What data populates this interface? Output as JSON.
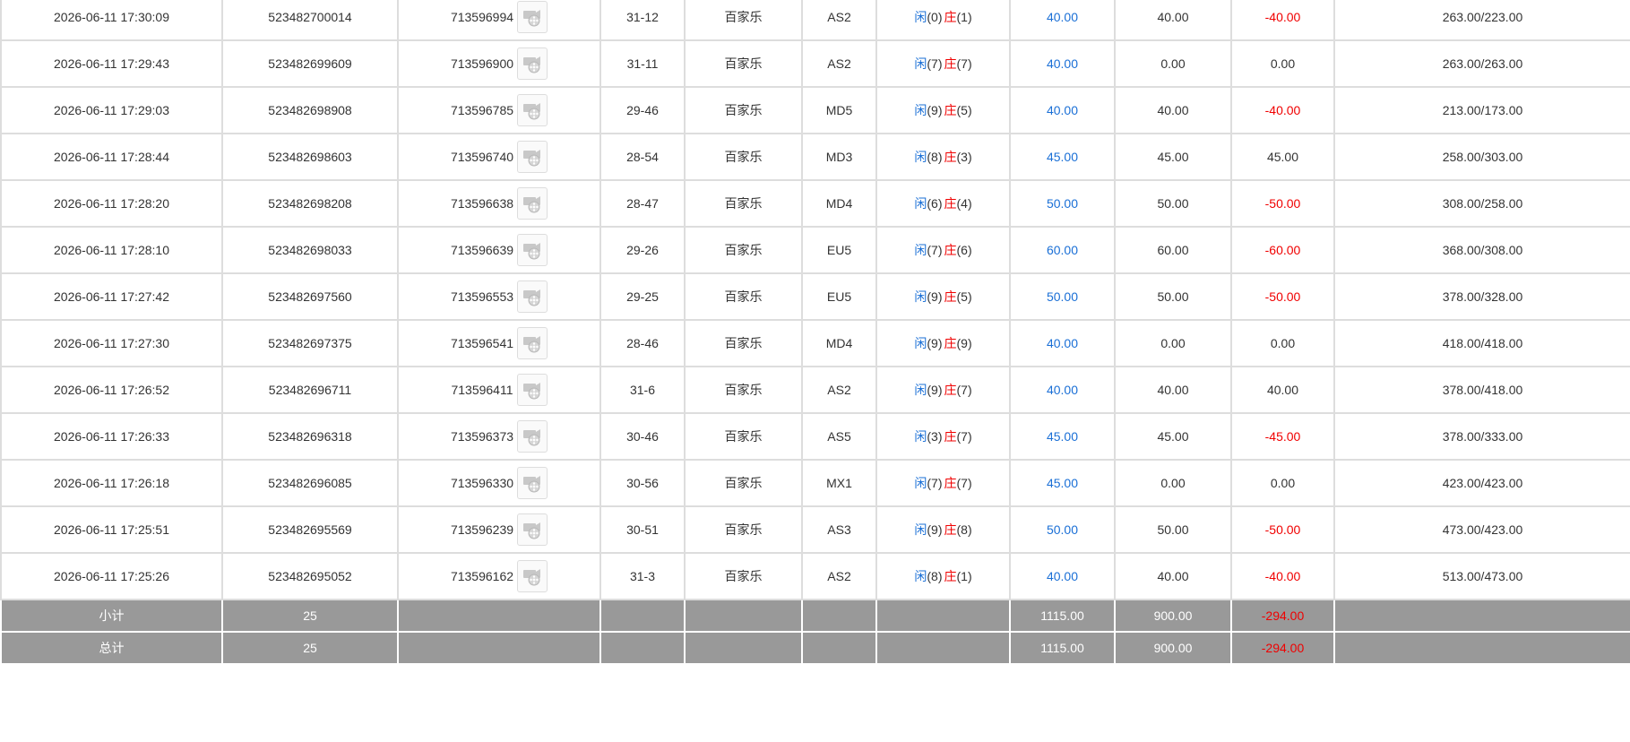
{
  "rows": [
    {
      "time": "2026-06-11 17:30:09",
      "order_id": "523482700014",
      "game_id": "713596994",
      "round": "31-12",
      "game": "百家乐",
      "table": "AS2",
      "p_label": "闲",
      "p_val": "(0)",
      "b_label": "庄",
      "b_val": "(1)",
      "bet": "40.00",
      "valid": "40.00",
      "win": "-40.00",
      "win_neg": true,
      "balance": "263.00/223.00"
    },
    {
      "time": "2026-06-11 17:29:43",
      "order_id": "523482699609",
      "game_id": "713596900",
      "round": "31-11",
      "game": "百家乐",
      "table": "AS2",
      "p_label": "闲",
      "p_val": "(7)",
      "b_label": "庄",
      "b_val": "(7)",
      "bet": "40.00",
      "valid": "0.00",
      "win": "0.00",
      "win_neg": false,
      "balance": "263.00/263.00"
    },
    {
      "time": "2026-06-11 17:29:03",
      "order_id": "523482698908",
      "game_id": "713596785",
      "round": "29-46",
      "game": "百家乐",
      "table": "MD5",
      "p_label": "闲",
      "p_val": "(9)",
      "b_label": "庄",
      "b_val": "(5)",
      "bet": "40.00",
      "valid": "40.00",
      "win": "-40.00",
      "win_neg": true,
      "balance": "213.00/173.00"
    },
    {
      "time": "2026-06-11 17:28:44",
      "order_id": "523482698603",
      "game_id": "713596740",
      "round": "28-54",
      "game": "百家乐",
      "table": "MD3",
      "p_label": "闲",
      "p_val": "(8)",
      "b_label": "庄",
      "b_val": "(3)",
      "bet": "45.00",
      "valid": "45.00",
      "win": "45.00",
      "win_neg": false,
      "balance": "258.00/303.00"
    },
    {
      "time": "2026-06-11 17:28:20",
      "order_id": "523482698208",
      "game_id": "713596638",
      "round": "28-47",
      "game": "百家乐",
      "table": "MD4",
      "p_label": "闲",
      "p_val": "(6)",
      "b_label": "庄",
      "b_val": "(4)",
      "bet": "50.00",
      "valid": "50.00",
      "win": "-50.00",
      "win_neg": true,
      "balance": "308.00/258.00"
    },
    {
      "time": "2026-06-11 17:28:10",
      "order_id": "523482698033",
      "game_id": "713596639",
      "round": "29-26",
      "game": "百家乐",
      "table": "EU5",
      "p_label": "闲",
      "p_val": "(7)",
      "b_label": "庄",
      "b_val": "(6)",
      "bet": "60.00",
      "valid": "60.00",
      "win": "-60.00",
      "win_neg": true,
      "balance": "368.00/308.00"
    },
    {
      "time": "2026-06-11 17:27:42",
      "order_id": "523482697560",
      "game_id": "713596553",
      "round": "29-25",
      "game": "百家乐",
      "table": "EU5",
      "p_label": "闲",
      "p_val": "(9)",
      "b_label": "庄",
      "b_val": "(5)",
      "bet": "50.00",
      "valid": "50.00",
      "win": "-50.00",
      "win_neg": true,
      "balance": "378.00/328.00"
    },
    {
      "time": "2026-06-11 17:27:30",
      "order_id": "523482697375",
      "game_id": "713596541",
      "round": "28-46",
      "game": "百家乐",
      "table": "MD4",
      "p_label": "闲",
      "p_val": "(9)",
      "b_label": "庄",
      "b_val": "(9)",
      "bet": "40.00",
      "valid": "0.00",
      "win": "0.00",
      "win_neg": false,
      "balance": "418.00/418.00"
    },
    {
      "time": "2026-06-11 17:26:52",
      "order_id": "523482696711",
      "game_id": "713596411",
      "round": "31-6",
      "game": "百家乐",
      "table": "AS2",
      "p_label": "闲",
      "p_val": "(9)",
      "b_label": "庄",
      "b_val": "(7)",
      "bet": "40.00",
      "valid": "40.00",
      "win": "40.00",
      "win_neg": false,
      "balance": "378.00/418.00"
    },
    {
      "time": "2026-06-11 17:26:33",
      "order_id": "523482696318",
      "game_id": "713596373",
      "round": "30-46",
      "game": "百家乐",
      "table": "AS5",
      "p_label": "闲",
      "p_val": "(3)",
      "b_label": "庄",
      "b_val": "(7)",
      "bet": "45.00",
      "valid": "45.00",
      "win": "-45.00",
      "win_neg": true,
      "balance": "378.00/333.00"
    },
    {
      "time": "2026-06-11 17:26:18",
      "order_id": "523482696085",
      "game_id": "713596330",
      "round": "30-56",
      "game": "百家乐",
      "table": "MX1",
      "p_label": "闲",
      "p_val": "(7)",
      "b_label": "庄",
      "b_val": "(7)",
      "bet": "45.00",
      "valid": "0.00",
      "win": "0.00",
      "win_neg": false,
      "balance": "423.00/423.00"
    },
    {
      "time": "2026-06-11 17:25:51",
      "order_id": "523482695569",
      "game_id": "713596239",
      "round": "30-51",
      "game": "百家乐",
      "table": "AS3",
      "p_label": "闲",
      "p_val": "(9)",
      "b_label": "庄",
      "b_val": "(8)",
      "bet": "50.00",
      "valid": "50.00",
      "win": "-50.00",
      "win_neg": true,
      "balance": "473.00/423.00"
    },
    {
      "time": "2026-06-11 17:25:26",
      "order_id": "523482695052",
      "game_id": "713596162",
      "round": "31-3",
      "game": "百家乐",
      "table": "AS2",
      "p_label": "闲",
      "p_val": "(8)",
      "b_label": "庄",
      "b_val": "(1)",
      "bet": "40.00",
      "valid": "40.00",
      "win": "-40.00",
      "win_neg": true,
      "balance": "513.00/473.00"
    }
  ],
  "subtotal": {
    "label": "小计",
    "count": "25",
    "bet": "1115.00",
    "valid": "900.00",
    "win": "-294.00"
  },
  "total": {
    "label": "总计",
    "count": "25",
    "bet": "1115.00",
    "valid": "900.00",
    "win": "-294.00"
  },
  "icons": {
    "video_replay": "video-replay-icon"
  },
  "colors": {
    "player": "#1a6fd6",
    "banker": "#f00000",
    "loss": "#f00000",
    "bet": "#1a6fd6",
    "summary_bg": "#999999"
  }
}
